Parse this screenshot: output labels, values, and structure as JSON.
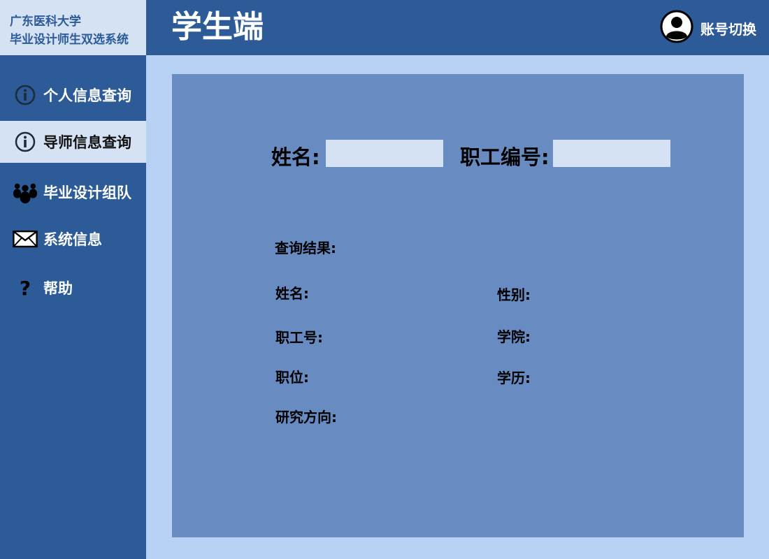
{
  "brand": {
    "line1": "广东医科大学",
    "line2": "毕业设计师生双选系统"
  },
  "header": {
    "title": "学生端",
    "account_switch": "账号切换",
    "account_icon": "user-avatar-icon"
  },
  "sidebar": {
    "items": [
      {
        "label": "个人信息查询",
        "icon": "info-icon",
        "active": false
      },
      {
        "label": "导师信息查询",
        "icon": "info-icon",
        "active": true
      },
      {
        "label": "毕业设计组队",
        "icon": "group-icon",
        "active": false
      },
      {
        "label": "系统信息",
        "icon": "mail-icon",
        "active": false
      },
      {
        "label": "帮助",
        "icon": "help-icon",
        "active": false
      }
    ]
  },
  "query": {
    "name_label": "姓名:",
    "name_value": "",
    "staff_id_label": "职工编号:",
    "staff_id_value": ""
  },
  "result": {
    "heading": "查询结果:",
    "name_label": "姓名:",
    "gender_label": "性别:",
    "staff_no_label": "职工号:",
    "college_label": "学院:",
    "position_label": "职位:",
    "education_label": "学历:",
    "research_label": "研究方向:"
  },
  "colors": {
    "primary": "#2c5b98",
    "light": "#d4e2f4",
    "background": "#b7d1f4",
    "panel": "#688cc2"
  }
}
